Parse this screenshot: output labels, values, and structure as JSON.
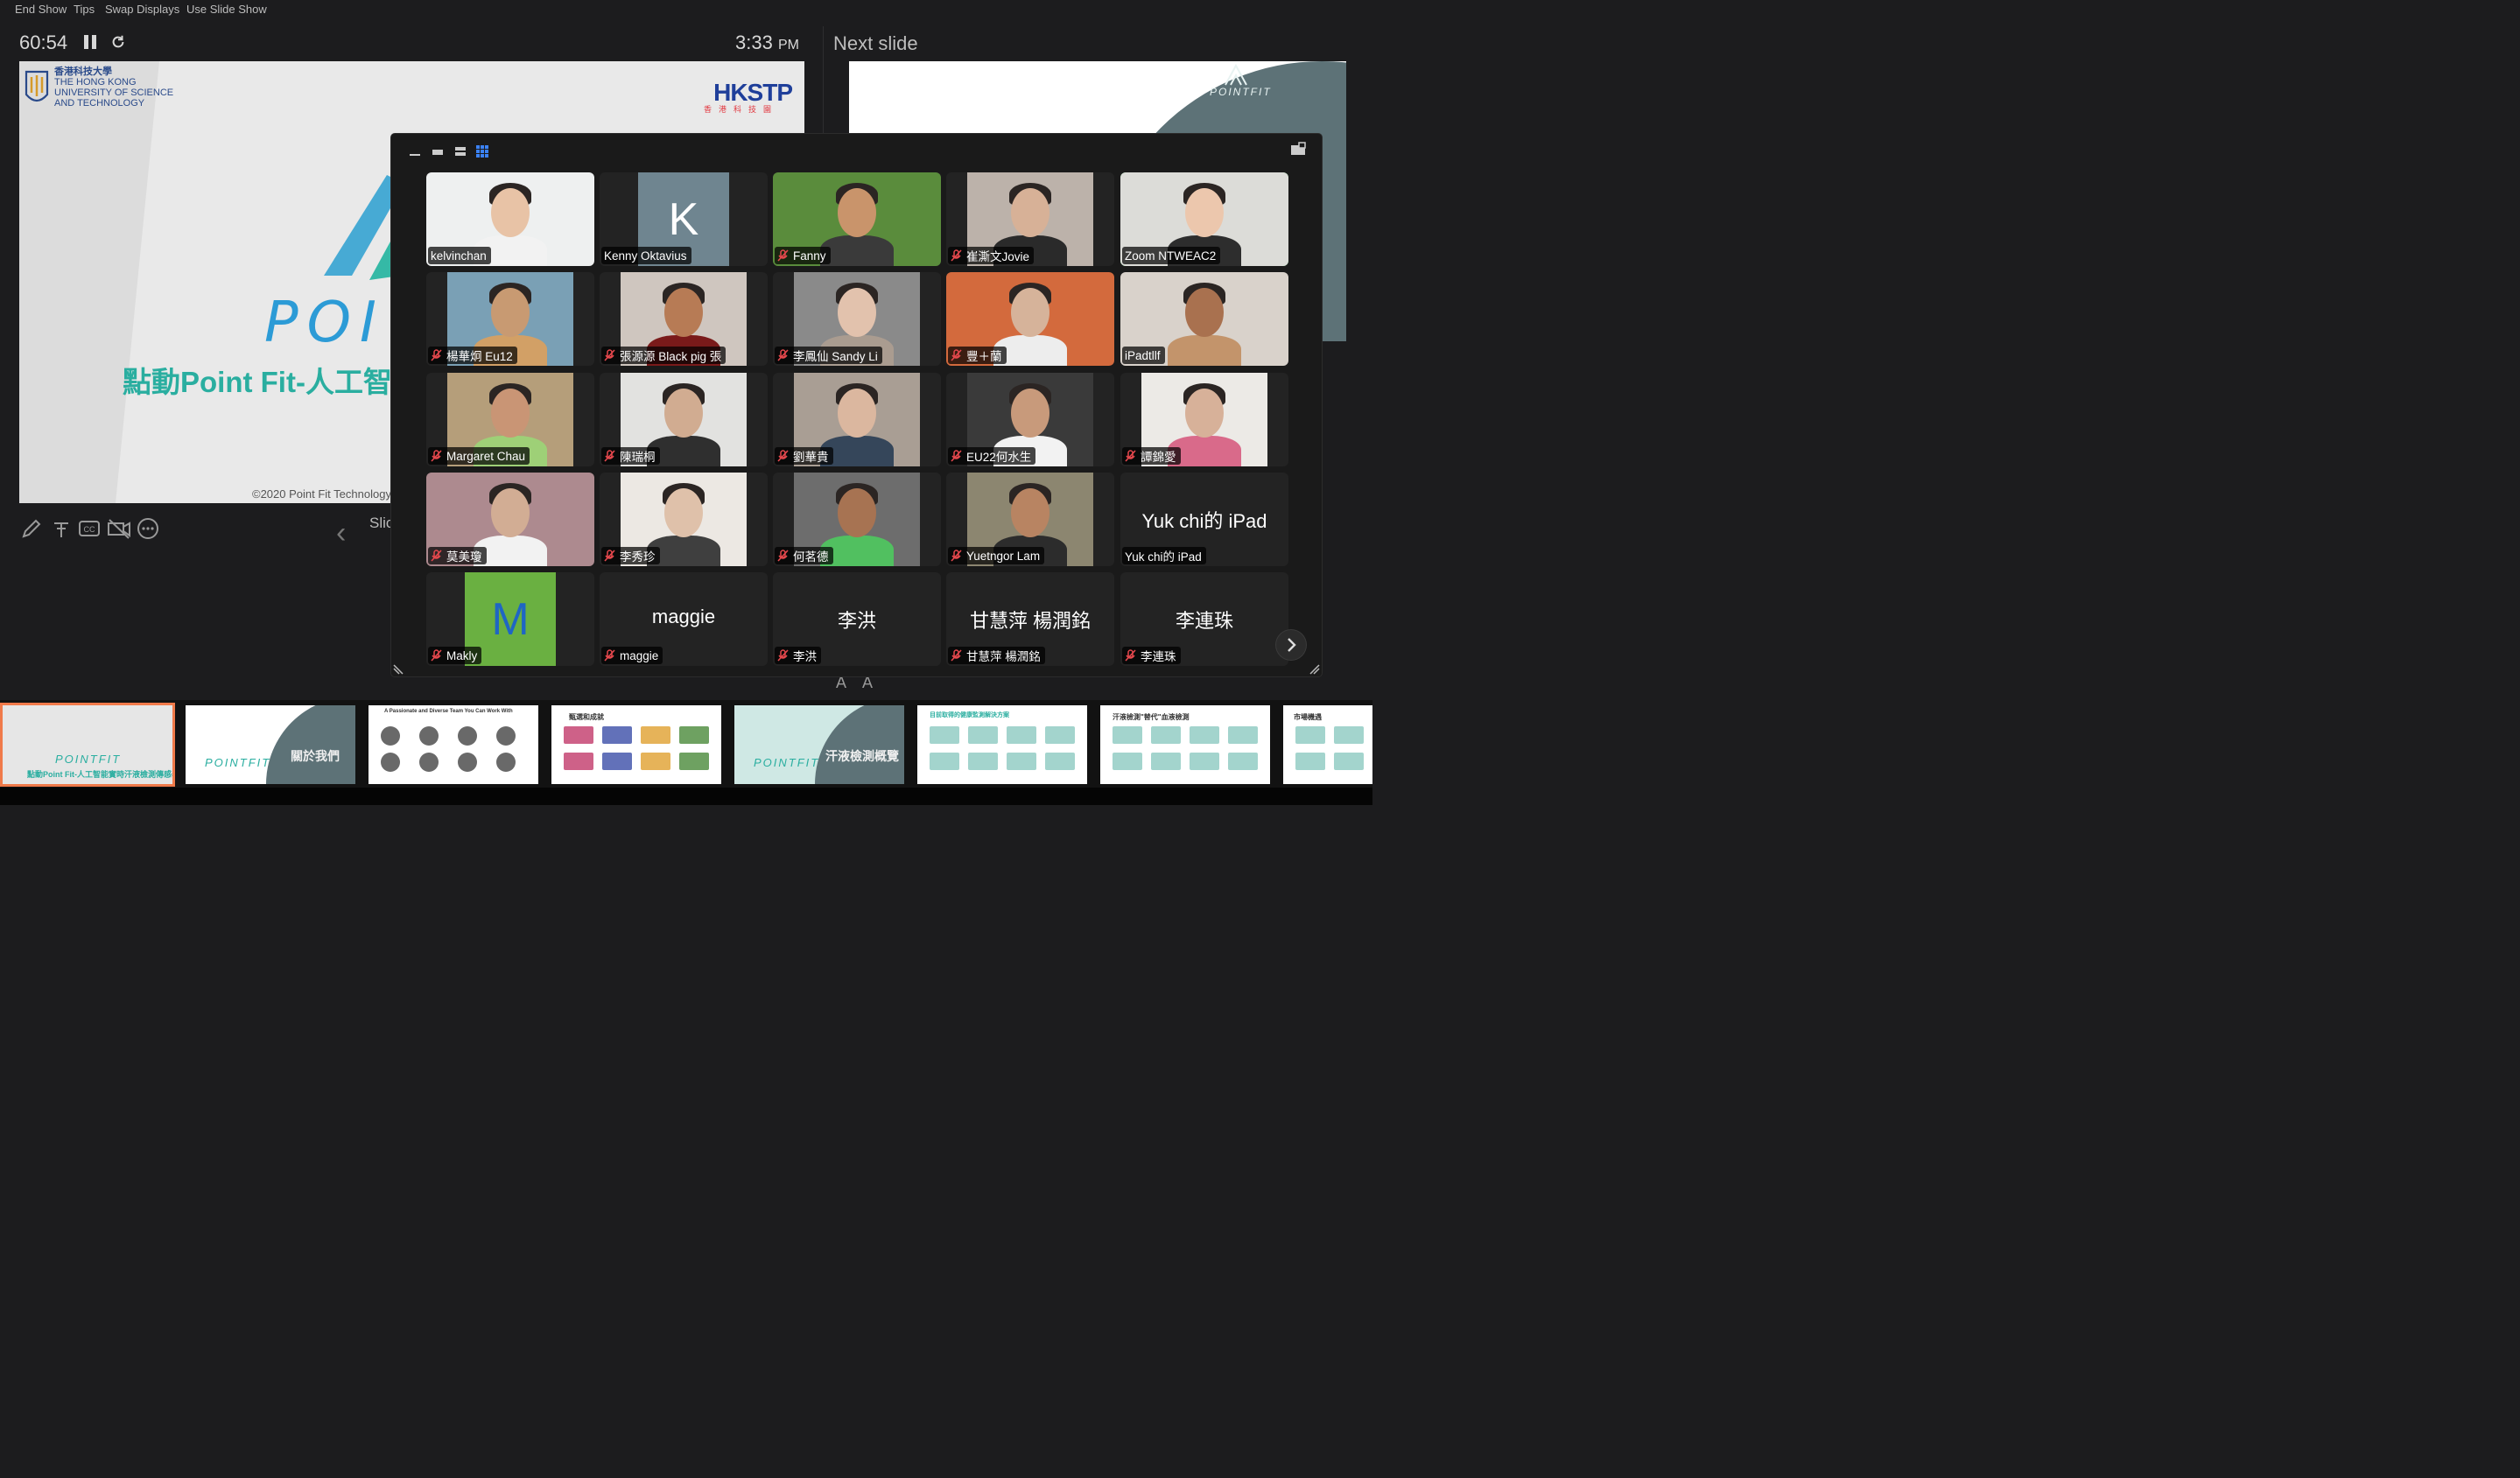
{
  "menu": {
    "end_show": "End Show",
    "tips": "Tips",
    "swap_displays": "Swap Displays",
    "use_slide_show": "Use Slide Show"
  },
  "presenter": {
    "timer": "60:54",
    "clock_time": "3:33",
    "clock_ampm": "PM",
    "next_slide_label": "Next slide",
    "slide_nav_label": "Slic"
  },
  "current_slide": {
    "hkust_cn": "香港科技大學",
    "hkust_en_1": "THE HONG KONG",
    "hkust_en_2": "UNIVERSITY OF SCIENCE",
    "hkust_en_3": "AND TECHNOLOGY",
    "hkstp_logo": "HKSTP",
    "hkstp_sub": "香港科技園",
    "brand_partial": "POI",
    "title": "點動Point Fit-人工智",
    "copyright": "©2020 Point Fit Technology"
  },
  "next_slide": {
    "brand": "POINTFIT"
  },
  "zoom": {
    "participants": [
      {
        "name": "kelvinchan",
        "muted": false,
        "type": "video",
        "skin": "#e8c3a6",
        "bg": "#eef0f0",
        "shirt": "#f2f2f2"
      },
      {
        "name": "Kenny Oktavius",
        "muted": false,
        "type": "letter",
        "letter": "K",
        "bg": "#6f8590"
      },
      {
        "name": "Fanny",
        "muted": true,
        "type": "video",
        "skin": "#c9946b",
        "bg": "#5a8c3c",
        "shirt": "#3a3a3a"
      },
      {
        "name": "崔澌文Jovie",
        "muted": true,
        "type": "video",
        "skin": "#d7b197",
        "bg": "#bcb2aa",
        "shirt": "#2a2a2a"
      },
      {
        "name": "Zoom NTWEAC2",
        "muted": false,
        "type": "video",
        "skin": "#ecc7ad",
        "bg": "#dcdcd8",
        "shirt": "#2d2d2d",
        "active": true
      },
      {
        "name": "楊華炯 Eu12",
        "muted": true,
        "type": "video",
        "skin": "#c89a72",
        "bg": "#7aa0b5",
        "shirt": "#d2a066"
      },
      {
        "name": "張源源 Black pig 張",
        "muted": true,
        "type": "video",
        "skin": "#b77b55",
        "bg": "#cfc6bf",
        "shirt": "#7a1a1a"
      },
      {
        "name": "李鳳仙 Sandy Li",
        "muted": true,
        "type": "video",
        "skin": "#e2c2ad",
        "bg": "#8a8a8a",
        "shirt": "#aa9c90"
      },
      {
        "name": "豐＋蘭",
        "muted": true,
        "type": "video",
        "skin": "#d6b39a",
        "bg": "#d36a3d",
        "shirt": "#ededed"
      },
      {
        "name": "iPadtllf",
        "muted": false,
        "type": "video",
        "skin": "#a9714f",
        "bg": "#d9d2cb",
        "shirt": "#c3946b"
      },
      {
        "name": "Margaret Chau",
        "muted": true,
        "type": "video",
        "skin": "#c99575",
        "bg": "#b59e7a",
        "shirt": "#9ed077"
      },
      {
        "name": "陳瑞桐",
        "muted": true,
        "type": "video",
        "skin": "#d1ac91",
        "bg": "#e2e2e0",
        "shirt": "#2f2f2f"
      },
      {
        "name": "劉華貴",
        "muted": true,
        "type": "video",
        "skin": "#dbb79f",
        "bg": "#a99e94",
        "shirt": "#35465a"
      },
      {
        "name": "EU22何水生",
        "muted": true,
        "type": "video",
        "skin": "#c89a7b",
        "bg": "#3a3a3a",
        "shirt": "#f2f2f2"
      },
      {
        "name": "譚錦愛",
        "muted": true,
        "type": "video",
        "skin": "#d7b199",
        "bg": "#eceae6",
        "shirt": "#d96a8a"
      },
      {
        "name": "莫美瓊",
        "muted": true,
        "type": "video",
        "skin": "#d2ad94",
        "bg": "#ad8a8f",
        "shirt": "#f2f2f2"
      },
      {
        "name": "李秀珍",
        "muted": true,
        "type": "video",
        "skin": "#dfc1aa",
        "bg": "#ece8e3",
        "shirt": "#3f3f3f"
      },
      {
        "name": "何茗德",
        "muted": true,
        "type": "video",
        "skin": "#a77352",
        "bg": "#6d6d6d",
        "shirt": "#51c060"
      },
      {
        "name": "Yuetngor Lam",
        "muted": true,
        "type": "video",
        "skin": "#b88462",
        "bg": "#8c8670",
        "shirt": "#2c2c2c"
      },
      {
        "name": "Yuk chi的 iPad",
        "muted": false,
        "type": "name",
        "big": "Yuk chi的 iPad"
      },
      {
        "name": "Makly",
        "muted": true,
        "type": "letter",
        "letter": "M",
        "bg": "#6ab041"
      },
      {
        "name": "maggie",
        "muted": true,
        "type": "name",
        "big": "maggie"
      },
      {
        "name": "李洪",
        "muted": true,
        "type": "name",
        "big": "李洪"
      },
      {
        "name": "甘慧萍 楊潤銘",
        "muted": true,
        "type": "name",
        "big": "甘慧萍 楊潤銘"
      },
      {
        "name": "李連珠",
        "muted": true,
        "type": "name",
        "big": "李連珠"
      }
    ]
  },
  "filmstrip": {
    "thumbs": [
      {
        "label": "點動Point Fit-人工智能實時汗液檢測傳感器",
        "brand": "POINTFIT"
      },
      {
        "label": "關於我們",
        "brand": "POINTFIT"
      },
      {
        "label": "A Passionate and Diverse Team You Can Work With",
        "brand": ""
      },
      {
        "label": "甄選和成就",
        "brand": ""
      },
      {
        "label": "汗液檢測概覽",
        "brand": "POINTFIT"
      },
      {
        "label": "目前取得的健康監測解決方案",
        "brand": ""
      },
      {
        "label": "汗液檢測\"替代\"血液檢測",
        "brand": ""
      },
      {
        "label": "市場機遇",
        "brand": ""
      }
    ]
  },
  "colors": {
    "active_speaker": "#28d04a",
    "muted_icon": "#e5484d",
    "teal": "#2aaea0"
  }
}
